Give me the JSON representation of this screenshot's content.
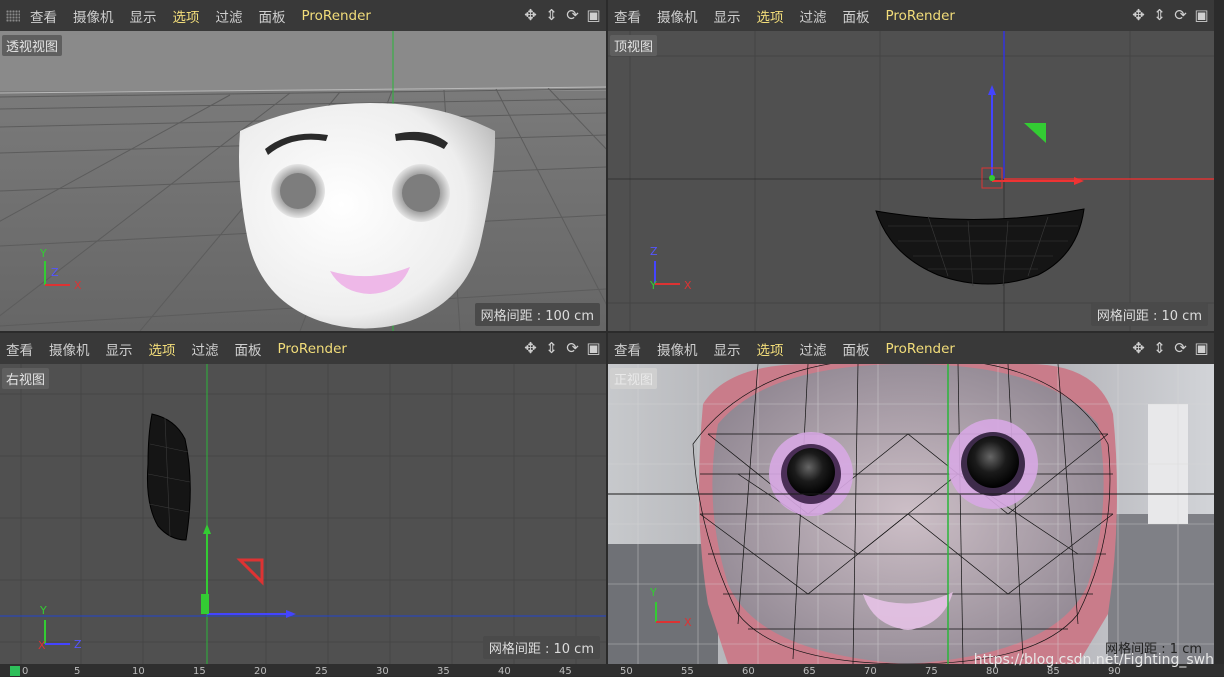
{
  "menus": [
    "查看",
    "摄像机",
    "显示",
    "选项",
    "过滤",
    "面板",
    "ProRender"
  ],
  "active_menu": "选项",
  "icons": [
    "move-icon",
    "arrow-down-icon",
    "rotate-icon",
    "layout-icon"
  ],
  "viewports": {
    "perspective": {
      "name": "透视视图",
      "grid": "网格间距 : 100 cm"
    },
    "top": {
      "name": "顶视图",
      "grid": "网格间距 : 10 cm"
    },
    "right": {
      "name": "右视图",
      "grid": "网格间距 : 10 cm"
    },
    "front": {
      "name": "正视图",
      "grid": "网格间距 : 1 cm"
    }
  },
  "axes": {
    "x": "X",
    "y": "Y",
    "z": "Z"
  },
  "timeline": [
    "0",
    "5",
    "10",
    "15",
    "20",
    "25",
    "30",
    "35",
    "40",
    "45",
    "50",
    "55",
    "60",
    "65",
    "70",
    "75",
    "80",
    "85",
    "90"
  ],
  "watermark": "https://blog.csdn.net/Fighting_swh",
  "colors": {
    "active_menu": "#f2dd7a",
    "x_axis": "#d33",
    "y_axis": "#3c3",
    "z_axis": "#33d",
    "playhead": "#2ebf5a"
  }
}
